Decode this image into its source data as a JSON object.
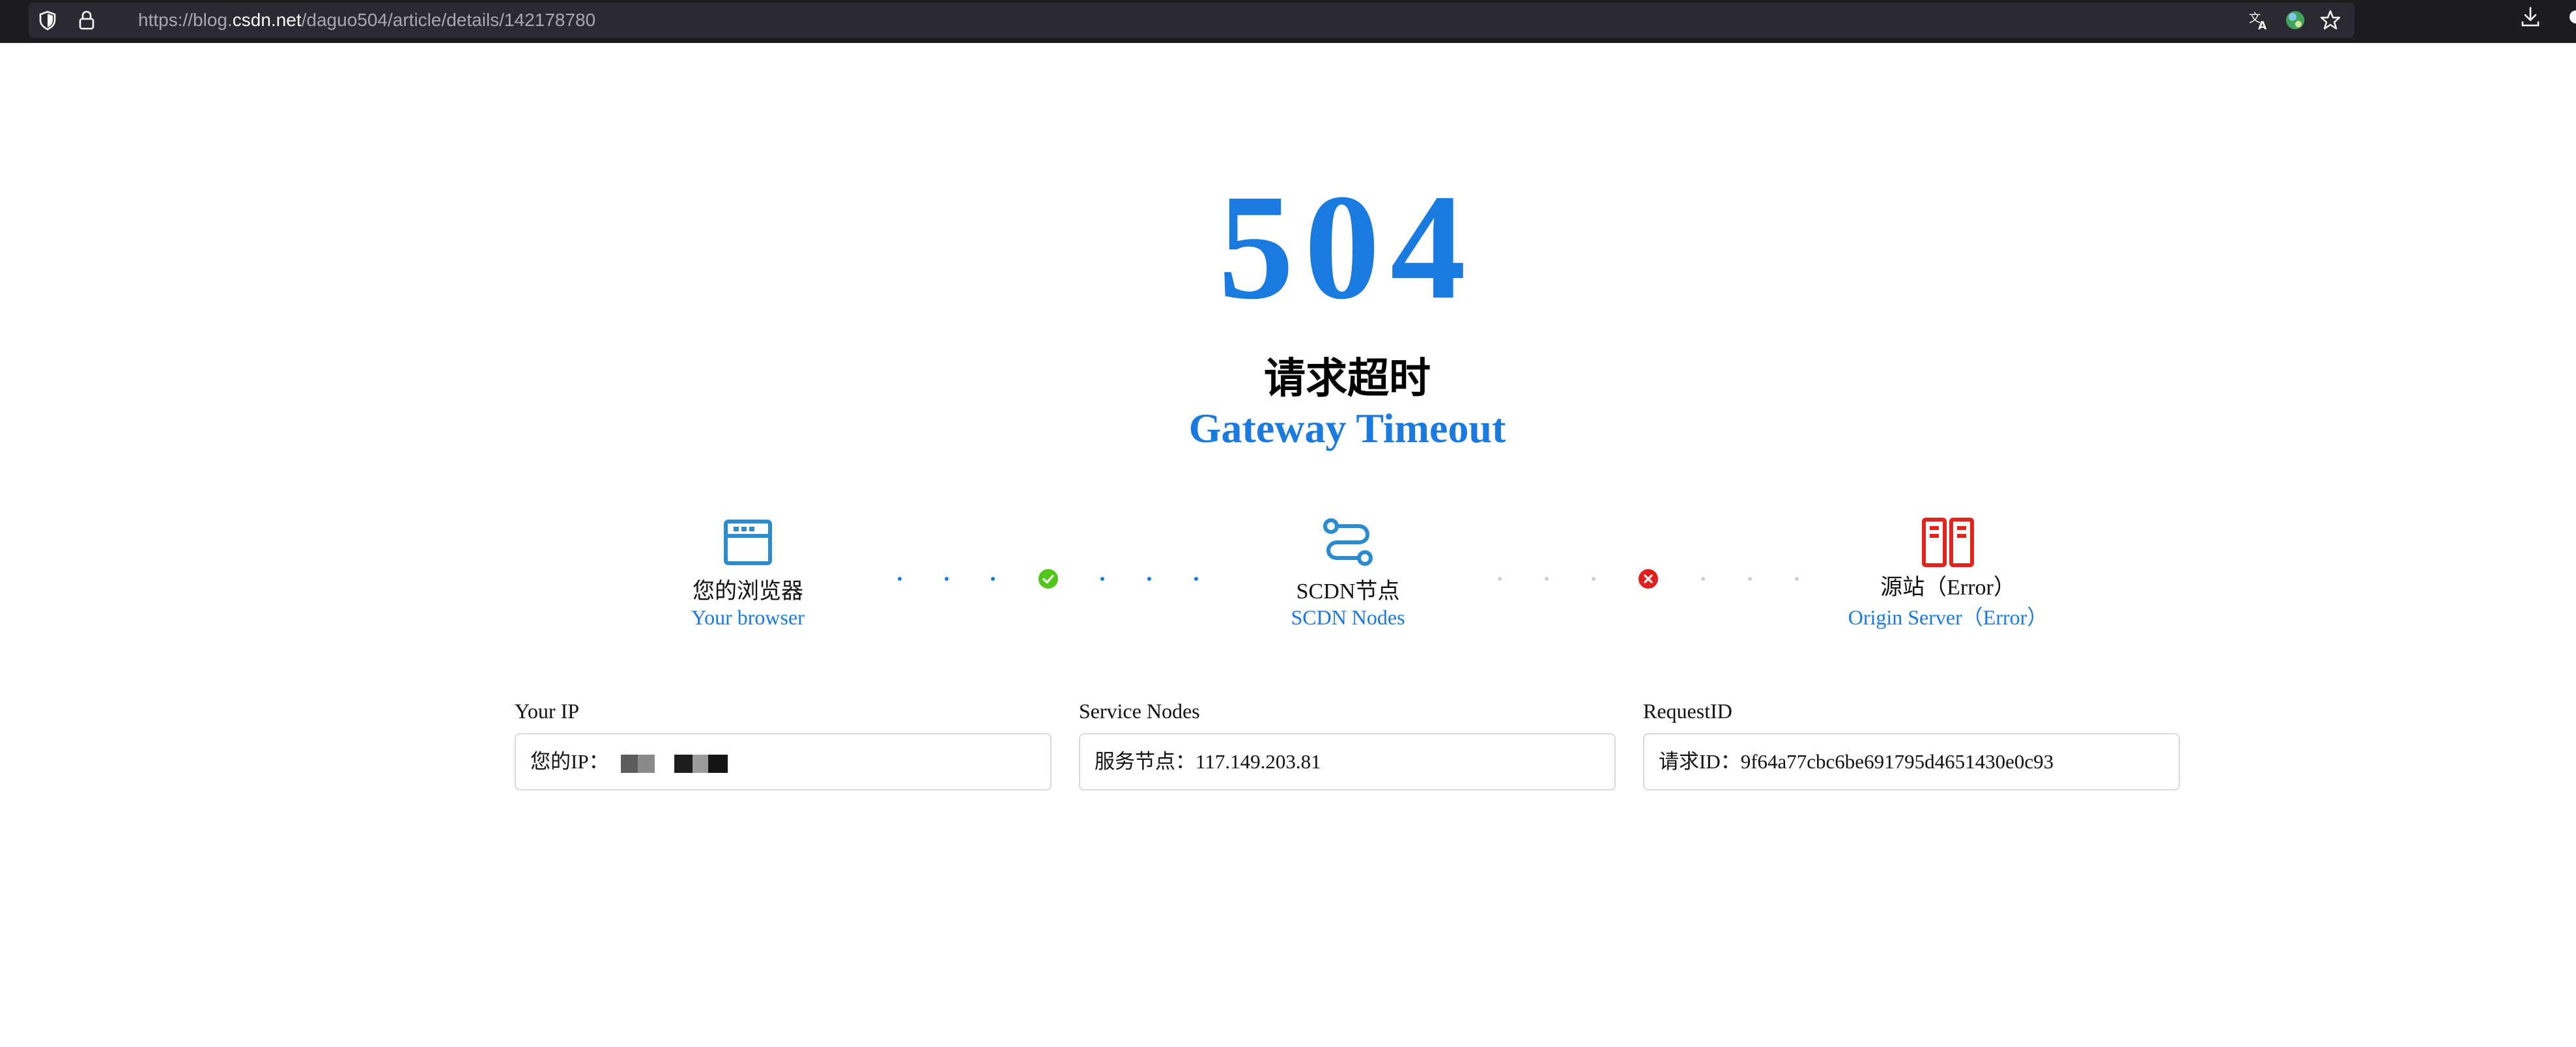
{
  "browser": {
    "url_prefix": "https://blog.",
    "url_host": "csdn.net",
    "url_path": "/daguo504/article/details/142178780"
  },
  "error": {
    "code": "504",
    "title_cn": "请求超时",
    "title_en": "Gateway Timeout"
  },
  "flow": {
    "browser": {
      "cn": "您的浏览器",
      "en": "Your browser",
      "status": "ok"
    },
    "scdn": {
      "cn": "SCDN节点",
      "en": "SCDN Nodes",
      "status": "error"
    },
    "origin": {
      "cn": "源站（Error）",
      "en": "Origin Server（Error）"
    }
  },
  "info": {
    "ip": {
      "label": "Your IP",
      "prefix": "您的IP："
    },
    "nodes": {
      "label": "Service Nodes",
      "value": "服务节点：117.149.203.81"
    },
    "request": {
      "label": "RequestID",
      "value": "请求ID：9f64a77cbc6be691795d4651430e0c93"
    }
  },
  "colors": {
    "accent": "#1a7ae0",
    "success": "#52c41a",
    "error": "#e0201f",
    "origin_icon": "#e3241e",
    "browser_icon": "#2a8bd0"
  }
}
